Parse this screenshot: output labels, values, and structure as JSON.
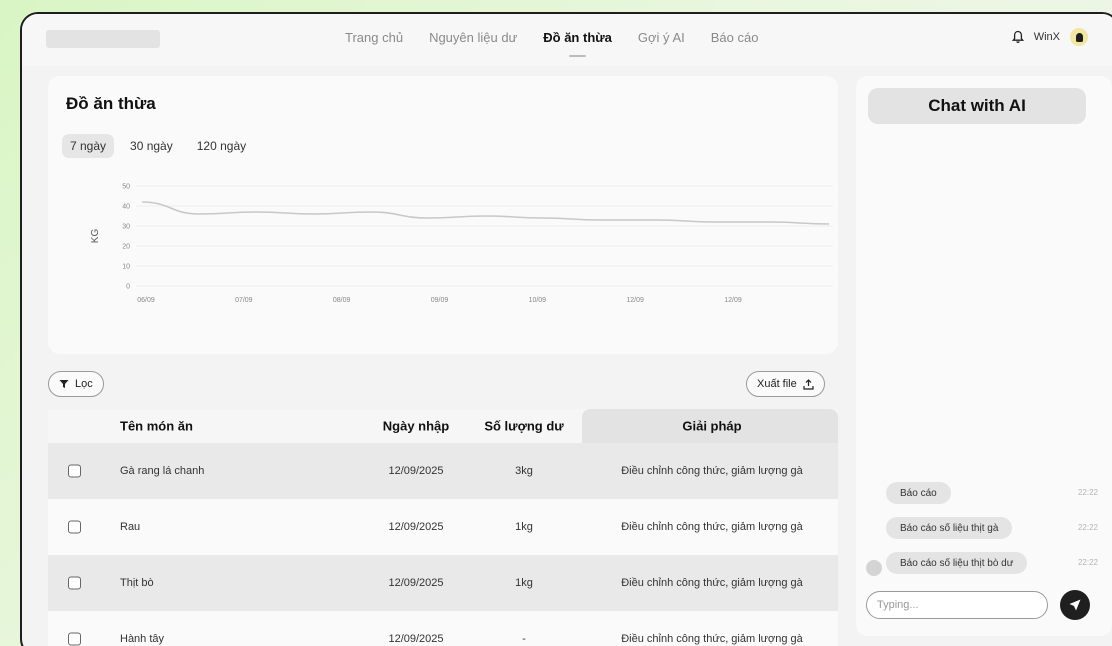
{
  "nav": {
    "items": [
      {
        "label": "Trang chủ"
      },
      {
        "label": "Nguyên liệu dư"
      },
      {
        "label": "Đồ ăn thừa"
      },
      {
        "label": "Gợi ý AI"
      },
      {
        "label": "Báo cáo"
      }
    ],
    "active_index": 2
  },
  "user": {
    "name": "WinX",
    "bell_icon": "bell-icon"
  },
  "waste_card": {
    "title": "Đồ ăn thừa",
    "ranges": [
      "7 ngày",
      "30 ngày",
      "120 ngày"
    ],
    "active_range": 0
  },
  "chart_data": {
    "type": "line",
    "title": "",
    "ylabel": "KG",
    "xlabel": "",
    "ylim": [
      0,
      50
    ],
    "yticks": [
      0,
      10,
      20,
      30,
      40,
      50
    ],
    "categories": [
      "06/09",
      "07/09",
      "08/09",
      "09/09",
      "10/09",
      "12/09",
      "12/09"
    ],
    "x": [
      0,
      0.5,
      1,
      1.5,
      2,
      2.5,
      3,
      3.5,
      4,
      4.5,
      5,
      5.5,
      6
    ],
    "values": [
      42,
      36,
      37,
      36,
      37,
      34,
      35,
      34,
      33,
      33,
      32,
      32,
      31
    ],
    "grid": true,
    "color": "#c8c8c8"
  },
  "toolbar": {
    "filter_label": "Lọc",
    "export_label": "Xuất file"
  },
  "table": {
    "headers": {
      "name": "Tên món ăn",
      "date": "Ngày nhập",
      "qty": "Số lượng dư",
      "solution": "Giải pháp"
    },
    "rows": [
      {
        "name": "Gà rang lá chanh",
        "date": "12/09/2025",
        "qty": "3kg",
        "solution": "Điều chỉnh công thức, giảm lượng gà"
      },
      {
        "name": "Rau",
        "date": "12/09/2025",
        "qty": "1kg",
        "solution": "Điều chỉnh công thức, giảm lượng gà"
      },
      {
        "name": "Thịt bò",
        "date": "12/09/2025",
        "qty": "1kg",
        "solution": "Điều chỉnh công thức, giảm lượng gà"
      },
      {
        "name": "Hành tây",
        "date": "12/09/2025",
        "qty": "-",
        "solution": "Điều chỉnh công thức, giảm lượng gà"
      }
    ]
  },
  "chat": {
    "title": "Chat with AI",
    "messages": [
      {
        "text": "Báo cáo",
        "time": "22:22"
      },
      {
        "text": "Báo cáo số liệu thịt gà",
        "time": "22:22"
      },
      {
        "text": "Báo cáo số liệu thịt bò dư",
        "time": "22:22"
      }
    ],
    "input_placeholder": "Typing..."
  }
}
